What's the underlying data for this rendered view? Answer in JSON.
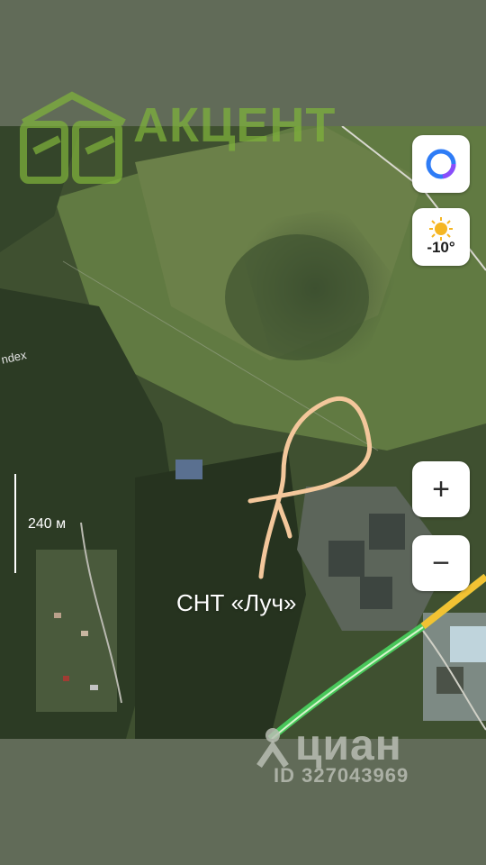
{
  "watermark_logo": {
    "text": "АКЦЕНТ",
    "color": "#7fb33b"
  },
  "map": {
    "provider_text": "ndex",
    "scale_label": "240 м",
    "place_label": "СНТ «Луч»",
    "road_color": "#48c75a",
    "highway_color": "#f2c233"
  },
  "controls": {
    "alice_icon": "alice-ring-icon",
    "weather_icon": "sun-icon",
    "temperature": "-10°",
    "zoom_in_label": "+",
    "zoom_out_label": "−"
  },
  "watermark_cian": {
    "name": "циан",
    "id_text": "ID 327043969"
  }
}
